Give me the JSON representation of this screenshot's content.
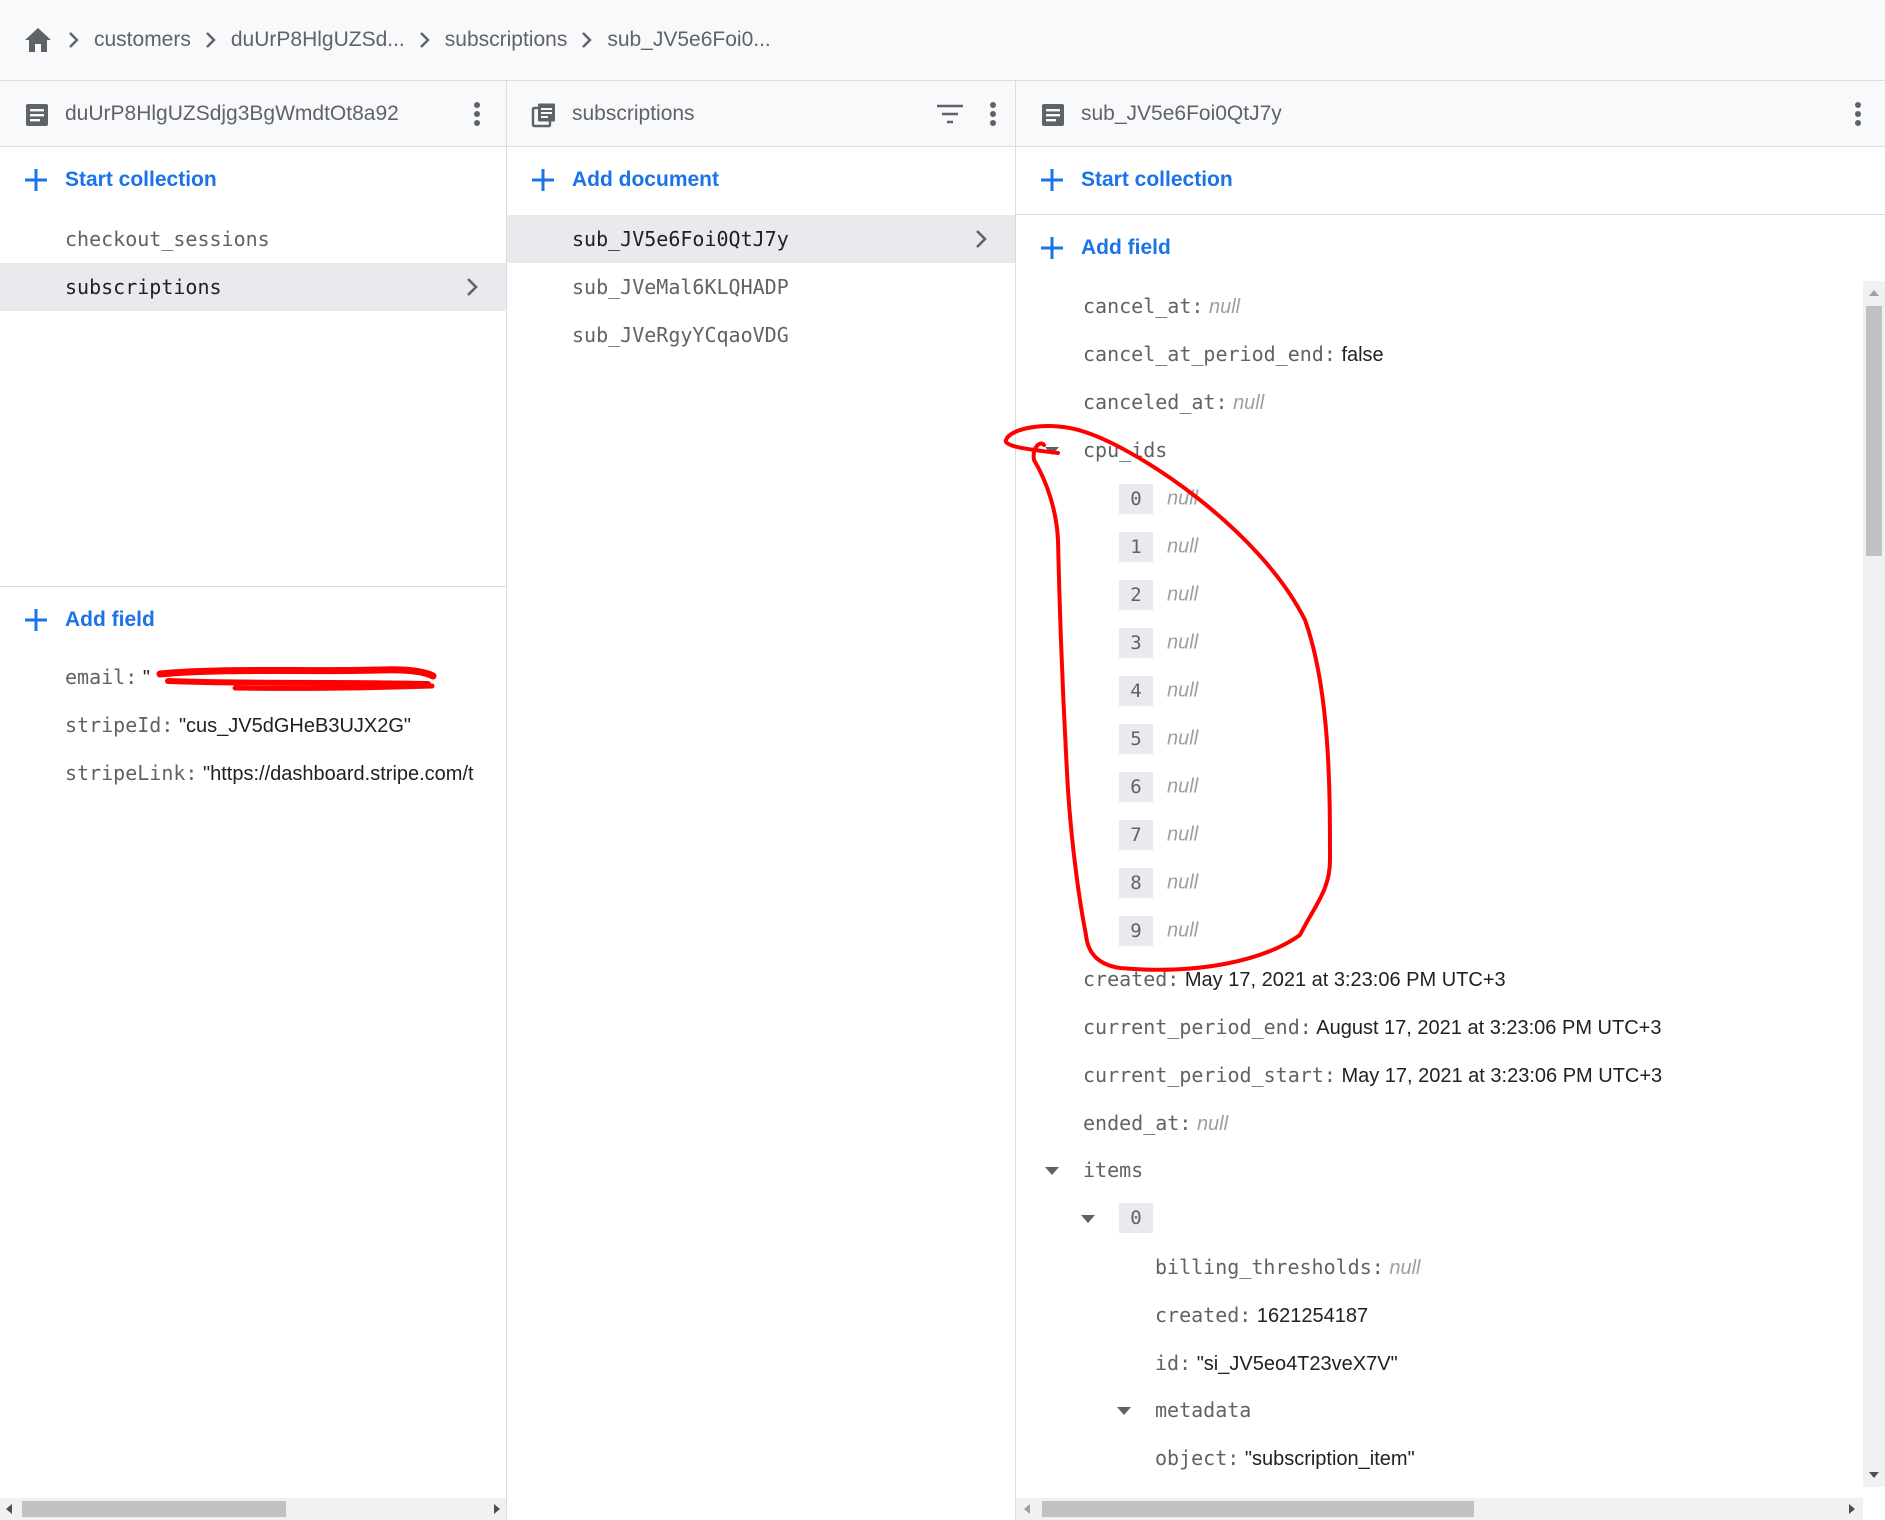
{
  "breadcrumb": {
    "items": [
      "customers",
      "duUrP8HlgUZSd...",
      "subscriptions",
      "sub_JV5e6Foi0..."
    ]
  },
  "panel1": {
    "title": "duUrP8HlgUZSdjg3BgWmdtOt8a92",
    "start_collection": "Start collection",
    "collections": [
      "checkout_sessions",
      "subscriptions"
    ],
    "add_field": "Add field",
    "fields": [
      {
        "key": "email:",
        "value": "\""
      },
      {
        "key": "stripeId:",
        "value": "\"cus_JV5dGHeB3UJX2G\""
      },
      {
        "key": "stripeLink:",
        "value": "\"https://dashboard.stripe.com/t"
      }
    ]
  },
  "panel2": {
    "title": "subscriptions",
    "add_document": "Add document",
    "documents": [
      "sub_JV5e6Foi0QtJ7y",
      "sub_JVeMal6KLQHADP",
      "sub_JVeRgyYCqaoVDG"
    ]
  },
  "panel3": {
    "title": "sub_JV5e6Foi0QtJ7y",
    "start_collection": "Start collection",
    "add_field": "Add field",
    "null_text": "null",
    "cancel_at": {
      "key": "cancel_at:"
    },
    "cancel_at_period_end": {
      "key": "cancel_at_period_end:",
      "value": "false"
    },
    "canceled_at": {
      "key": "canceled_at:"
    },
    "cpu_ids": {
      "key": "cpu_ids",
      "indices": [
        "0",
        "1",
        "2",
        "3",
        "4",
        "5",
        "6",
        "7",
        "8",
        "9"
      ]
    },
    "created": {
      "key": "created:",
      "value": "May 17, 2021 at 3:23:06 PM UTC+3"
    },
    "current_period_end": {
      "key": "current_period_end:",
      "value": "August 17, 2021 at 3:23:06 PM UTC+3"
    },
    "current_period_start": {
      "key": "current_period_start:",
      "value": "May 17, 2021 at 3:23:06 PM UTC+3"
    },
    "ended_at": {
      "key": "ended_at:"
    },
    "items": {
      "key": "items",
      "index0": "0",
      "billing_thresholds": {
        "key": "billing_thresholds:"
      },
      "created": {
        "key": "created:",
        "value": "1621254187"
      },
      "id": {
        "key": "id:",
        "value": "\"si_JV5eo4T23veX7V\""
      },
      "metadata": {
        "key": "metadata"
      },
      "object": {
        "key": "object:",
        "value": "\"subscription_item\""
      }
    }
  },
  "colors": {
    "accent": "#1a73e8",
    "annotation": "#ff0000",
    "selected_row": "#e8eaed",
    "header_bg": "#f8f9fa"
  }
}
